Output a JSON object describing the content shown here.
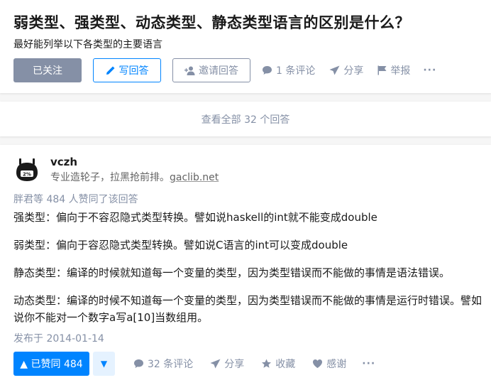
{
  "question": {
    "title": "弱类型、强类型、动态类型、静态类型语言的区别是什么？",
    "detail": "最好能列举以下各类型的主要语言",
    "actions": {
      "followed_label": "已关注",
      "write_label": "写回答",
      "invite_label": "邀请回答",
      "comment_label": "1 条评论",
      "share_label": "分享",
      "report_label": "举报",
      "more_label": "···"
    }
  },
  "view_all_label": "查看全部 32 个回答",
  "answer": {
    "author": {
      "name": "vczh",
      "bio_text": "专业造轮子，拉黑抢前排。",
      "bio_url": "gaclib.net",
      "avatar_badge": "2%"
    },
    "voters_text": "胖君等 484 人赞同了该回答",
    "paragraphs": [
      "强类型：偏向于不容忍隐式类型转换。譬如说haskell的int就不能变成double",
      "弱类型：偏向于容忍隐式类型转换。譬如说C语言的int可以变成double",
      "静态类型：编译的时候就知道每一个变量的类型，因为类型错误而不能做的事情是语法错误。",
      "动态类型：编译的时候不知道每一个变量的类型，因为类型错误而不能做的事情是运行时错误。譬如说你不能对一个数字a写a[10]当数组用。"
    ],
    "publish_date": "发布于 2014-01-14",
    "actions": {
      "vote_up_label": "▲ 已赞同 484",
      "vote_down_label": "▼",
      "comment_label": "32 条评论",
      "share_label": "分享",
      "collect_label": "收藏",
      "thanks_label": "感谢",
      "more_label": "···"
    }
  },
  "colors": {
    "brand_blue": "#0084ff",
    "gray_text": "#8590a6",
    "followed_bg": "#8590a6",
    "vote_down_bg": "#e5f2ff"
  }
}
